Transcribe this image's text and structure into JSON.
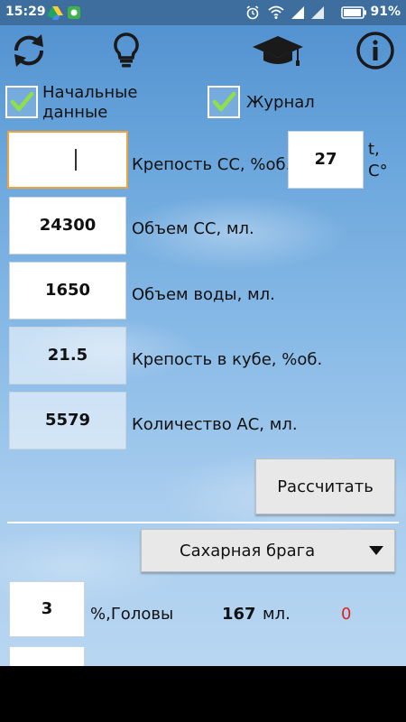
{
  "status_bar": {
    "time": "15:29",
    "battery": "91%"
  },
  "toolbar": {
    "icons": [
      "refresh-icon",
      "lightbulb-icon",
      "graduation-cap-icon",
      "info-icon"
    ]
  },
  "checkboxes": {
    "initial_data": {
      "label_line1": "Начальные",
      "label_line2": "данные",
      "checked": true
    },
    "journal": {
      "label": "Журнал",
      "checked": true
    }
  },
  "form": {
    "strength_ss": {
      "value": "",
      "label": "Крепость СС, %об."
    },
    "temperature": {
      "value": "27",
      "unit_line1": "t,",
      "unit_line2": "C°"
    },
    "volume_ss": {
      "value": "24300",
      "label": "Объем СС, мл."
    },
    "volume_water": {
      "value": "1650",
      "label": "Объем воды, мл."
    },
    "strength_cube": {
      "value": "21.5",
      "label": "Крепость в кубе, %об."
    },
    "amount_as": {
      "value": "5579",
      "label": "Количество АС, мл."
    }
  },
  "calculate_button": {
    "label": "Рассчитать"
  },
  "mash_select": {
    "selected": "Сахарная брага"
  },
  "heads": {
    "percent": "3",
    "label": "%,Головы",
    "volume": "167",
    "unit": "мл.",
    "extra": "0"
  },
  "colors": {
    "warning_red": "#e02020",
    "focus_orange": "#f2a23a"
  }
}
